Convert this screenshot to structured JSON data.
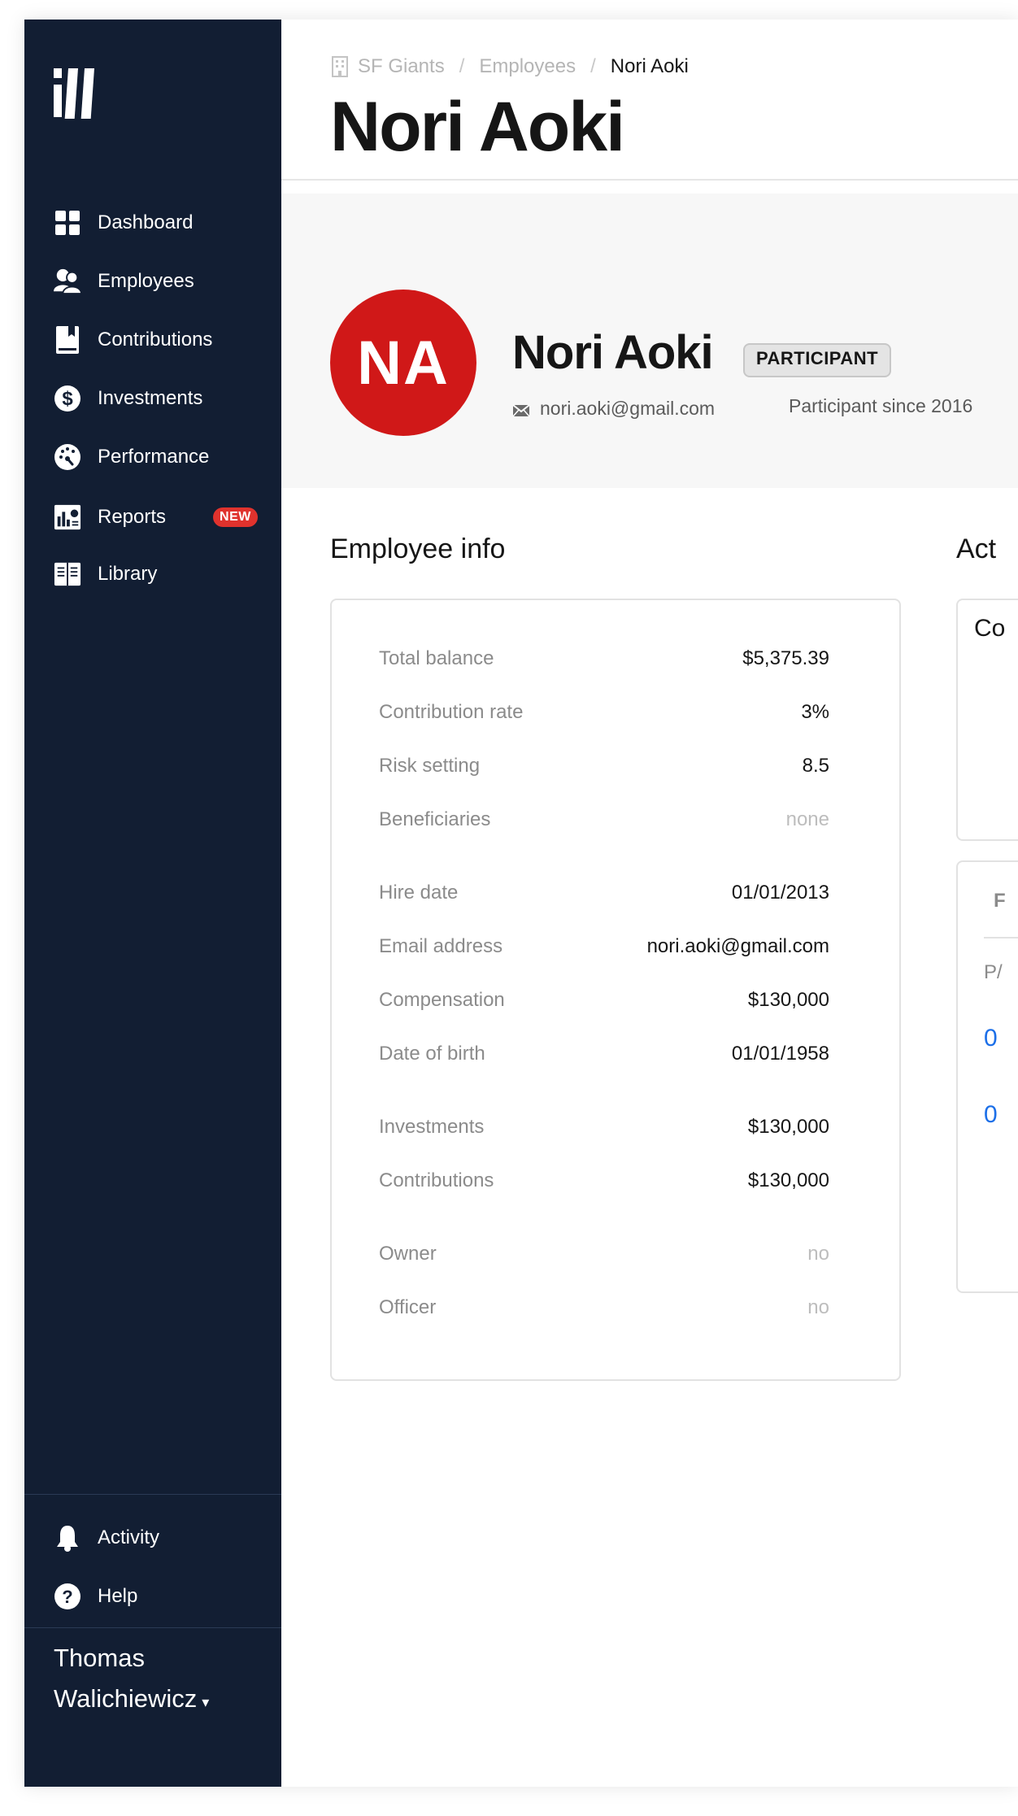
{
  "sidebar": {
    "items": [
      {
        "label": "Dashboard",
        "icon": "dashboard-grid-icon"
      },
      {
        "label": "Employees",
        "icon": "users-icon"
      },
      {
        "label": "Contributions",
        "icon": "contributions-book-icon"
      },
      {
        "label": "Investments",
        "icon": "dollar-circle-icon"
      },
      {
        "label": "Performance",
        "icon": "gauge-icon"
      },
      {
        "label": "Reports",
        "icon": "reports-chart-icon",
        "badge": "NEW"
      },
      {
        "label": "Library",
        "icon": "library-book-icon"
      }
    ],
    "bottom_items": [
      {
        "label": "Activity",
        "icon": "bell-icon"
      },
      {
        "label": "Help",
        "icon": "help-circle-icon"
      }
    ],
    "user": {
      "first": "Thomas",
      "last": "Walichiewicz",
      "caret": "▾"
    },
    "background": "#121e33",
    "badge_color": "#e0322d"
  },
  "breadcrumb": {
    "org": "SF Giants",
    "section": "Employees",
    "current": "Nori Aoki",
    "separator": "/"
  },
  "page": {
    "title": "Nori Aoki"
  },
  "profile": {
    "initials": "NA",
    "avatar_color": "#d01818",
    "name": "Nori Aoki",
    "role": "PARTICIPANT",
    "email": "nori.aoki@gmail.com",
    "since": "Participant since 2016"
  },
  "employee_info": {
    "title": "Employee info",
    "rows": [
      {
        "label": "Total balance",
        "value": "$5,375.39"
      },
      {
        "label": "Contribution rate",
        "value": "3%"
      },
      {
        "label": "Risk setting",
        "value": "8.5"
      },
      {
        "label": "Beneficiaries",
        "value": "none"
      },
      {
        "label": "Hire date",
        "value": "01/01/2013"
      },
      {
        "label": "Email address",
        "value": "nori.aoki@gmail.com"
      },
      {
        "label": "Compensation",
        "value": "$130,000"
      },
      {
        "label": "Date of birth",
        "value": "01/01/1958"
      },
      {
        "label": "Investments",
        "value": "$130,000"
      },
      {
        "label": "Contributions",
        "value": "$130,000"
      },
      {
        "label": "Owner",
        "value": "no"
      },
      {
        "label": "Officer",
        "value": "no"
      }
    ]
  },
  "activity": {
    "title_partial": "Act",
    "card1_partial": "Co",
    "card2": {
      "tab_partial": "F",
      "header_partial": "P/",
      "row1_partial": "0",
      "row2_partial": "0"
    }
  }
}
